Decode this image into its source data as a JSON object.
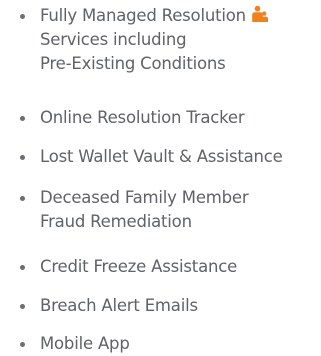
{
  "colors": {
    "text": "#5f6266",
    "bullet": "#6b6e72",
    "icon_accent": "#f0821e"
  },
  "features": [
    {
      "lines": [
        "Fully Managed Resolution",
        "Services including",
        "Pre-Existing Conditions"
      ],
      "icon": "family-icon"
    },
    {
      "lines": [
        "Online Resolution Tracker"
      ]
    },
    {
      "lines": [
        "Lost Wallet Vault & Assistance"
      ]
    },
    {
      "lines": [
        "Deceased Family Member",
        "Fraud Remediation"
      ]
    },
    {
      "lines": [
        "Credit Freeze Assistance"
      ]
    },
    {
      "lines": [
        "Breach Alert Emails"
      ]
    },
    {
      "lines": [
        "Mobile App"
      ]
    }
  ]
}
